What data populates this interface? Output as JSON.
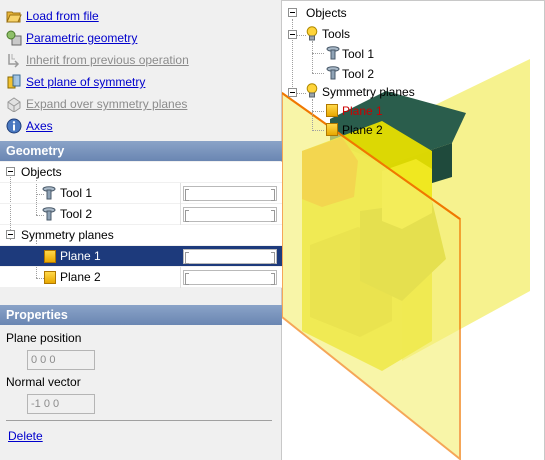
{
  "actions": [
    {
      "label": "Load from file",
      "icon": "folder-open-icon",
      "enabled": true
    },
    {
      "label": "Parametric geometry",
      "icon": "parametric-geometry-icon",
      "enabled": true
    },
    {
      "label": "Inherit from previous operation",
      "icon": "inherit-icon",
      "enabled": false
    },
    {
      "label": "Set plane of symmetry",
      "icon": "set-symmetry-plane-icon",
      "enabled": true
    },
    {
      "label": "Expand over symmetry planes",
      "icon": "expand-symmetry-icon",
      "enabled": false
    },
    {
      "label": "Axes",
      "icon": "axes-info-icon",
      "enabled": true
    }
  ],
  "geometry": {
    "header": "Geometry",
    "rows": [
      {
        "label": "Objects",
        "icon": null,
        "value": null
      },
      {
        "label": "Tool 1",
        "icon": "tool-icon",
        "value": ""
      },
      {
        "label": "Tool 2",
        "icon": "tool-icon",
        "value": ""
      },
      {
        "label": "Symmetry planes",
        "icon": null,
        "value": null
      },
      {
        "label": "Plane 1",
        "icon": "plane-icon",
        "value": "",
        "selected": true
      },
      {
        "label": "Plane 2",
        "icon": "plane-icon",
        "value": ""
      }
    ]
  },
  "properties": {
    "header": "Properties",
    "plane_position_label": "Plane position",
    "plane_position_value": "0 0 0",
    "normal_vector_label": "Normal vector",
    "normal_vector_value": "-1 0 0",
    "delete_label": "Delete"
  },
  "scene_tree": {
    "objects": "Objects",
    "tools": "Tools",
    "tool1": "Tool 1",
    "tool2": "Tool 2",
    "symmetry_planes": "Symmetry planes",
    "plane1": "Plane 1",
    "plane2": "Plane 2"
  },
  "colors": {
    "header_bg": "#7893bd",
    "selection_bg": "#1d3a7c",
    "link": "#0000cc",
    "plane_fill": "#f5f07a",
    "plane_edge": "#f07800",
    "part_teal": "#2a5d4c",
    "part_yellow": "#e8e000",
    "plane1_text": "#cc0000"
  }
}
